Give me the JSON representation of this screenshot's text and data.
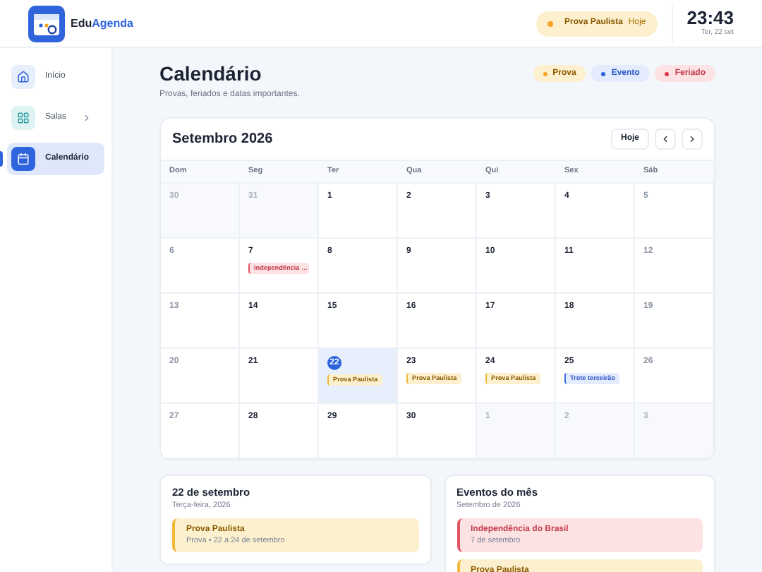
{
  "brand": {
    "first": "Edu",
    "second": "Agenda"
  },
  "today_pill": {
    "label": "Prova Paulista",
    "tag": "Hoje"
  },
  "clock": {
    "time": "23:43",
    "date": "Ter, 22 set"
  },
  "sidebar": {
    "items": [
      {
        "label": "Início",
        "selected": false,
        "chevron": false
      },
      {
        "label": "Salas",
        "selected": false,
        "chevron": true
      },
      {
        "label": "Calendário",
        "selected": true,
        "chevron": false
      }
    ]
  },
  "page": {
    "title": "Calendário",
    "subtitle": "Provas, feriados e datas importantes."
  },
  "legend": [
    {
      "label": "Prova",
      "kind": "prova"
    },
    {
      "label": "Evento",
      "kind": "evento"
    },
    {
      "label": "Feriado",
      "kind": "feriado"
    }
  ],
  "calendar": {
    "month": "Setembro 2026",
    "today_button": "Hoje",
    "weekdays": [
      "Dom",
      "Seg",
      "Ter",
      "Qua",
      "Qui",
      "Sex",
      "Sáb"
    ],
    "weeks": [
      [
        {
          "day": "30",
          "kind": "outside",
          "selected": false
        },
        {
          "day": "31",
          "kind": "outside",
          "selected": false
        },
        {
          "day": "1",
          "kind": "weekday",
          "selected": false
        },
        {
          "day": "2",
          "kind": "weekday",
          "selected": false
        },
        {
          "day": "3",
          "kind": "weekday",
          "selected": false
        },
        {
          "day": "4",
          "kind": "weekday",
          "selected": false
        },
        {
          "day": "5",
          "kind": "weekend",
          "selected": false
        }
      ],
      [
        {
          "day": "6",
          "kind": "weekend",
          "selected": false
        },
        {
          "day": "7",
          "kind": "weekday",
          "selected": false,
          "events": [
            {
              "label": "Independência …",
              "kind": "feriado"
            }
          ]
        },
        {
          "day": "8",
          "kind": "weekday",
          "selected": false
        },
        {
          "day": "9",
          "kind": "weekday",
          "selected": false
        },
        {
          "day": "10",
          "kind": "weekday",
          "selected": false
        },
        {
          "day": "11",
          "kind": "weekday",
          "selected": false
        },
        {
          "day": "12",
          "kind": "weekend",
          "selected": false
        }
      ],
      [
        {
          "day": "13",
          "kind": "weekend",
          "selected": false
        },
        {
          "day": "14",
          "kind": "weekday",
          "selected": false
        },
        {
          "day": "15",
          "kind": "weekday",
          "selected": false
        },
        {
          "day": "16",
          "kind": "weekday",
          "selected": false
        },
        {
          "day": "17",
          "kind": "weekday",
          "selected": false
        },
        {
          "day": "18",
          "kind": "weekday",
          "selected": false
        },
        {
          "day": "19",
          "kind": "weekend",
          "selected": false
        }
      ],
      [
        {
          "day": "20",
          "kind": "weekend",
          "selected": false
        },
        {
          "day": "21",
          "kind": "weekday",
          "selected": false
        },
        {
          "day": "22",
          "kind": "weekday",
          "selected": true,
          "events": [
            {
              "label": "Prova Paulista",
              "kind": "prova"
            }
          ]
        },
        {
          "day": "23",
          "kind": "weekday",
          "selected": false,
          "events": [
            {
              "label": "Prova Paulista",
              "kind": "prova"
            }
          ]
        },
        {
          "day": "24",
          "kind": "weekday",
          "selected": false,
          "events": [
            {
              "label": "Prova Paulista",
              "kind": "prova"
            }
          ]
        },
        {
          "day": "25",
          "kind": "weekday",
          "selected": false,
          "events": [
            {
              "label": "Trote terceirão",
              "kind": "evento"
            }
          ]
        },
        {
          "day": "26",
          "kind": "weekend",
          "selected": false
        }
      ],
      [
        {
          "day": "27",
          "kind": "weekend",
          "selected": false
        },
        {
          "day": "28",
          "kind": "weekday",
          "selected": false
        },
        {
          "day": "29",
          "kind": "weekday",
          "selected": false
        },
        {
          "day": "30",
          "kind": "weekday",
          "selected": false
        },
        {
          "day": "1",
          "kind": "outside",
          "selected": false
        },
        {
          "day": "2",
          "kind": "outside",
          "selected": false
        },
        {
          "day": "3",
          "kind": "outside",
          "selected": false
        }
      ]
    ]
  },
  "day_panel": {
    "title": "22 de setembro",
    "subtitle": "Terça-feira, 2026",
    "events": [
      {
        "title": "Prova Paulista",
        "detail": "Prova • 22 a 24 de setembro",
        "kind": "prova"
      }
    ]
  },
  "month_panel": {
    "title": "Eventos do mês",
    "subtitle": "Setembro de 2026",
    "events": [
      {
        "title": "Independência do Brasil",
        "detail": "7 de setembro",
        "kind": "feriado"
      },
      {
        "title": "Prova Paulista",
        "kind": "prova"
      }
    ]
  }
}
